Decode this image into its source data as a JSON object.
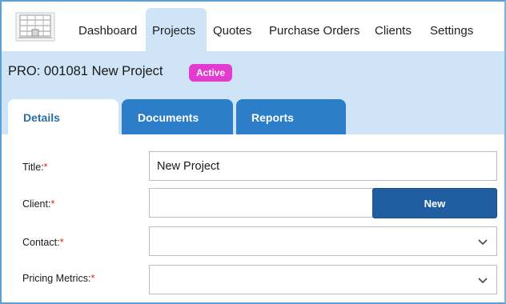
{
  "nav": {
    "items": [
      {
        "label": "Dashboard"
      },
      {
        "label": "Projects",
        "active": true
      },
      {
        "label": "Quotes"
      },
      {
        "label": "Purchase Orders"
      },
      {
        "label": "Clients"
      },
      {
        "label": "Settings"
      }
    ]
  },
  "project": {
    "title": "PRO: 001081 New Project",
    "status": "Active"
  },
  "tabs": [
    {
      "label": "Details",
      "active": true
    },
    {
      "label": "Documents"
    },
    {
      "label": "Reports"
    }
  ],
  "form": {
    "title_label": "Title:",
    "title_value": "New Project",
    "client_label": "Client:",
    "client_value": "",
    "new_button": "New",
    "contact_label": "Contact:",
    "contact_value": "",
    "pricing_label": "Pricing Metrics:",
    "pricing_value": "",
    "required_marker": "*"
  },
  "colors": {
    "accent": "#2c7ec8",
    "header_band": "#cfe4f6",
    "badge": "#e33ad0",
    "required": "#e02020",
    "button": "#1f5ea0"
  },
  "icons": {
    "logo": "building-logo-icon",
    "dropdown": "chevron-down-icon"
  }
}
